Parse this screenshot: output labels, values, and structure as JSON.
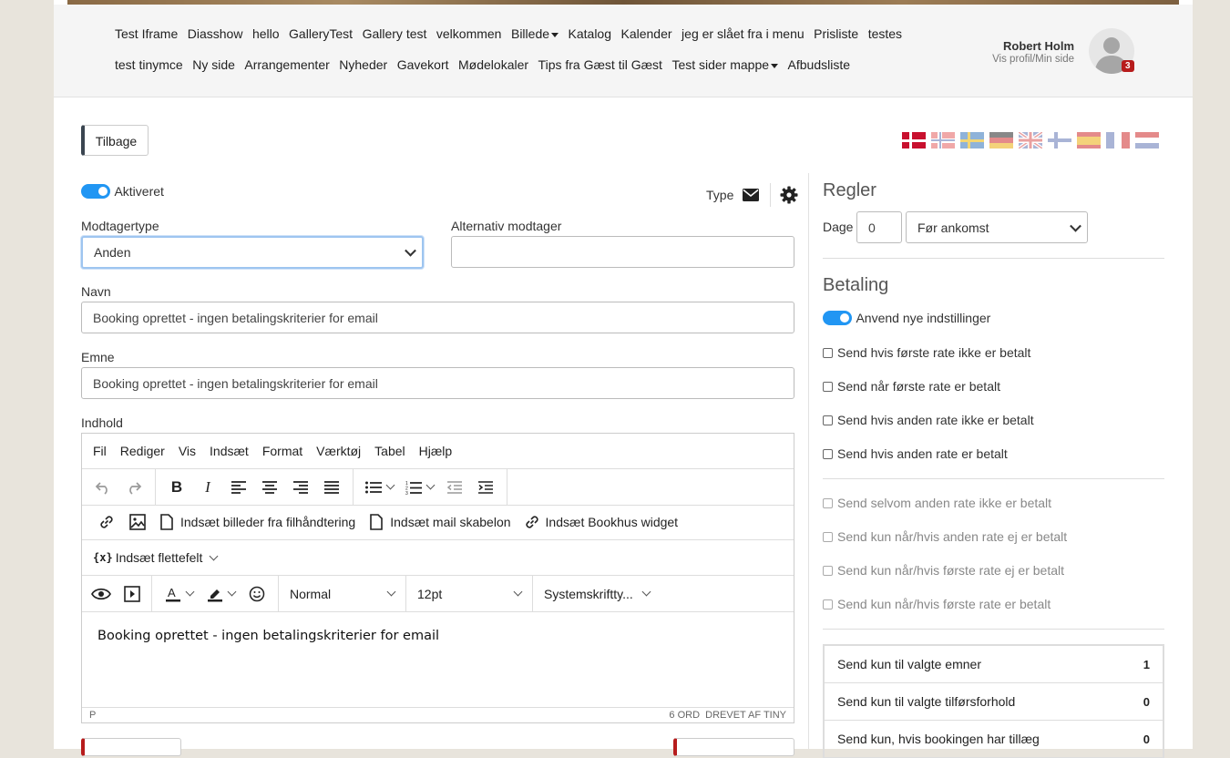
{
  "nav": {
    "row1": [
      {
        "label": "Test Iframe"
      },
      {
        "label": "Diasshow"
      },
      {
        "label": "hello"
      },
      {
        "label": "GalleryTest"
      },
      {
        "label": "Gallery test"
      },
      {
        "label": "velkommen"
      },
      {
        "label": "Billede"
      },
      {
        "label": "Katalog"
      },
      {
        "label": "Kalender"
      },
      {
        "label": "jeg er slået fra i menu"
      },
      {
        "label": "Prisliste"
      },
      {
        "label": "testes"
      }
    ],
    "row2": [
      {
        "label": "test tinymce"
      },
      {
        "label": "Ny side"
      },
      {
        "label": "Arrangementer"
      },
      {
        "label": "Nyheder"
      },
      {
        "label": "Gavekort"
      },
      {
        "label": "Mødelokaler"
      },
      {
        "label": "Tips fra Gæst til Gæst"
      },
      {
        "label": "Test sider mappe"
      },
      {
        "label": "Afbudsliste"
      }
    ]
  },
  "user": {
    "name": "Robert Holm",
    "subtitle": "Vis profil/Min side",
    "notifications": "3"
  },
  "back_label": "Tilbage",
  "flags": [
    "da",
    "no",
    "sv",
    "de",
    "en",
    "fi",
    "es",
    "fr",
    "nl"
  ],
  "form": {
    "activated_label": "Aktiveret",
    "type_label": "Type",
    "recipient_type_label": "Modtagertype",
    "recipient_type_value": "Anden",
    "alt_recipient_label": "Alternativ modtager",
    "alt_recipient_value": "",
    "name_label": "Navn",
    "name_value": "Booking oprettet - ingen betalingskriterier for email",
    "subject_label": "Emne",
    "subject_value": "Booking oprettet - ingen betalingskriterier for email",
    "content_label": "Indhold"
  },
  "editor": {
    "menu": [
      "Fil",
      "Rediger",
      "Vis",
      "Indsæt",
      "Format",
      "Værktøj",
      "Tabel",
      "Hjælp"
    ],
    "insert_files": "Indsæt billeder fra filhåndtering",
    "insert_mail_template": "Indsæt mail skabelon",
    "insert_widget": "Indsæt Bookhus widget",
    "insert_merge": "Indsæt flettefelt",
    "block_format": "Normal",
    "font_size": "12pt",
    "font_family": "Systemskriftty...",
    "content": "Booking oprettet - ingen betalingskriterier for email",
    "status_path": "P",
    "status_words": "6 ORD",
    "status_powered": "DREVET AF TINY"
  },
  "rules": {
    "title": "Regler",
    "days_label": "Dage",
    "days_value": "0",
    "timing_value": "Før ankomst"
  },
  "payment": {
    "title": "Betaling",
    "toggle_label": "Anvend nye indstillinger",
    "options": [
      "Send hvis første rate ikke er betalt",
      "Send når første rate er betalt",
      "Send hvis anden rate ikke er betalt",
      "Send hvis anden rate er betalt"
    ],
    "disabled_options": [
      "Send selvom anden rate ikke er betalt",
      "Send kun når/hvis anden rate ej er betalt",
      "Send kun når/hvis første rate ej er betalt",
      "Send kun når/hvis første rate er betalt"
    ]
  },
  "filters": [
    {
      "label": "Send kun til valgte emner",
      "count": "1"
    },
    {
      "label": "Send kun til valgte tilførsforhold",
      "count": "0"
    },
    {
      "label": "Send kun, hvis bookingen har tillæg",
      "count": "0"
    }
  ]
}
